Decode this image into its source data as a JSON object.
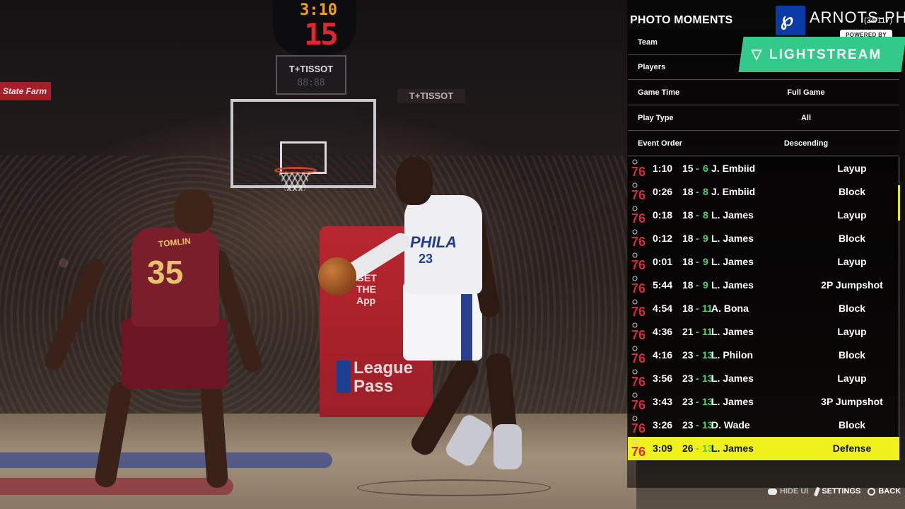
{
  "scene": {
    "game_clock": "3:10",
    "shot_clock": "15",
    "sponsor_hoop": "T+TISSOT",
    "sponsor_wall": "T+TISSOT",
    "sponsor_left": "State Farm",
    "stanchion_promo": "GET THE App",
    "league_pass": "League Pass",
    "defender_name": "TOMLIN",
    "defender_number": "35",
    "dribbler_jersey": "PHILA",
    "dribbler_number": "23"
  },
  "overlay": {
    "brand_text": "ARNOTS-PH",
    "brand_counter": "(24/117)",
    "powered_by": "POWERED BY",
    "lightstream": "LIGHTSTREAM"
  },
  "panel": {
    "title": "PHOTO MOMENTS",
    "filters": [
      {
        "label": "Team",
        "value": ""
      },
      {
        "label": "Players",
        "value": ""
      },
      {
        "label": "Game Time",
        "value": "Full Game"
      },
      {
        "label": "Play Type",
        "value": "All"
      },
      {
        "label": "Event Order",
        "value": "Descending"
      }
    ],
    "events": [
      {
        "time": "1:10",
        "score_home": "15",
        "score_away": "6",
        "player": "J. Embiid",
        "play": "Layup"
      },
      {
        "time": "0:26",
        "score_home": "18",
        "score_away": "8",
        "player": "J. Embiid",
        "play": "Block"
      },
      {
        "time": "0:18",
        "score_home": "18",
        "score_away": "8",
        "player": "L. James",
        "play": "Layup"
      },
      {
        "time": "0:12",
        "score_home": "18",
        "score_away": "9",
        "player": "L. James",
        "play": "Block"
      },
      {
        "time": "0:01",
        "score_home": "18",
        "score_away": "9",
        "player": "L. James",
        "play": "Layup"
      },
      {
        "time": "5:44",
        "score_home": "18",
        "score_away": "9",
        "player": "L. James",
        "play": "2P Jumpshot"
      },
      {
        "time": "4:54",
        "score_home": "18",
        "score_away": "11",
        "player": "A. Bona",
        "play": "Block"
      },
      {
        "time": "4:36",
        "score_home": "21",
        "score_away": "11",
        "player": "L. James",
        "play": "Layup"
      },
      {
        "time": "4:16",
        "score_home": "23",
        "score_away": "13",
        "player": "L. Philon",
        "play": "Block"
      },
      {
        "time": "3:56",
        "score_home": "23",
        "score_away": "13",
        "player": "L. James",
        "play": "Layup"
      },
      {
        "time": "3:43",
        "score_home": "23",
        "score_away": "13",
        "player": "L. James",
        "play": "3P Jumpshot"
      },
      {
        "time": "3:26",
        "score_home": "23",
        "score_away": "13",
        "player": "D. Wade",
        "play": "Block"
      },
      {
        "time": "3:09",
        "score_home": "26",
        "score_away": "13",
        "player": "L. James",
        "play": "Defense",
        "selected": true
      }
    ],
    "team_logo_text": "76",
    "colors": {
      "selected_row": "#eef21a",
      "away_score": "#4cd36a",
      "team_red": "#d62a37",
      "team_blue": "#1f3e8f"
    }
  },
  "footer": {
    "hide_ui": "HIDE UI",
    "settings": "SETTINGS",
    "back": "BACK"
  }
}
